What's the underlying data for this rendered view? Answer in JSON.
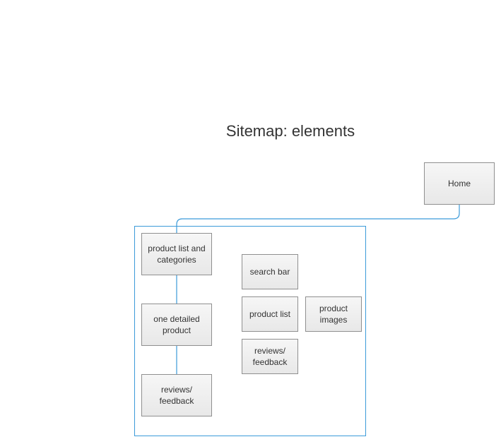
{
  "title": "Sitemap: elements",
  "colors": {
    "connector": "#3b9ad9",
    "group_border": "#3b9ad9",
    "node_border": "#8f8f8f",
    "node_fill_top": "#f6f6f6",
    "node_fill_bottom": "#e8e8e8",
    "text": "#333333"
  },
  "nodes": {
    "home": "Home",
    "product_list_and_categories": "product list and categories",
    "one_detailed_product": "one detailed product",
    "reviews_feedback_left": "reviews/ feedback",
    "search_bar": "search bar",
    "product_list": "product list",
    "product_images": "product images",
    "reviews_feedback_right": "reviews/ feedback"
  }
}
